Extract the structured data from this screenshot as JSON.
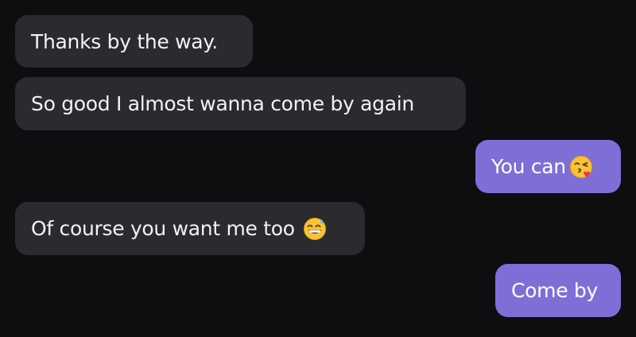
{
  "messages": [
    {
      "direction": "incoming",
      "text": "Thanks by the way."
    },
    {
      "direction": "incoming",
      "text": "So good I almost wanna come by again"
    },
    {
      "direction": "outgoing",
      "text": "You can",
      "emoji": "face-blowing-kiss-icon"
    },
    {
      "direction": "incoming",
      "text": "Of course you want me too",
      "emoji": "grinning-sweat-icon"
    },
    {
      "direction": "outgoing",
      "text": "Come by"
    }
  ],
  "colors": {
    "background": "#0e0d0f",
    "incoming_bubble": "#2b2a2e",
    "outgoing_bubble": "#7e6fd6",
    "text": "#f2f2f4"
  }
}
